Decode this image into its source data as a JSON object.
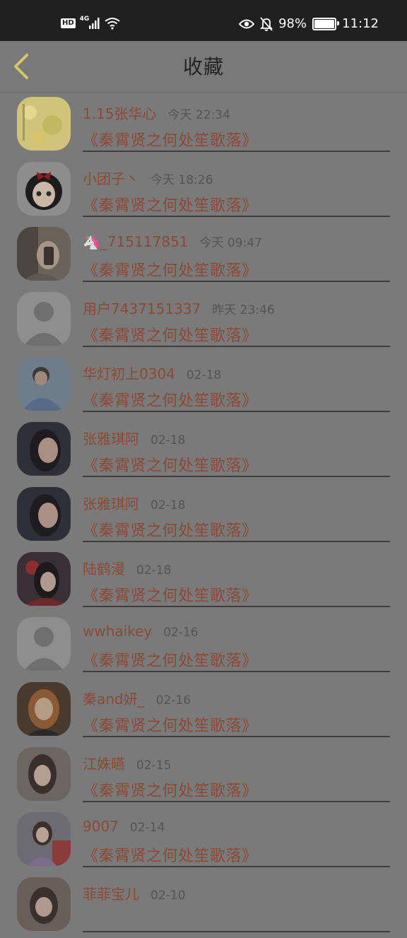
{
  "status_bar": {
    "hd": "HD",
    "network": "4G",
    "battery_percent": "98%",
    "battery_level": 0.98,
    "time": "11:12",
    "icons": [
      "hd-icon",
      "signal-icon",
      "wifi-icon",
      "eye-icon",
      "bell-muted-icon",
      "battery-icon"
    ]
  },
  "header": {
    "back_icon": "chevron-left-icon",
    "title": "收藏"
  },
  "colors": {
    "accent_text": "#8a4a36",
    "back_chevron": "#d6c36a",
    "overlay_bg": "#7a7a7a"
  },
  "favorites": [
    {
      "name": "1.15张华心",
      "time": "今天 22:34",
      "title": "《秦霄贤之何处笙歌落》",
      "avatar": "yellow-flowers"
    },
    {
      "name": "小团子丶",
      "time": "今天 18:26",
      "title": "《秦霄贤之何处笙歌落》",
      "avatar": "cartoon-girl"
    },
    {
      "name": "🦄_715117851",
      "time": "今天 09:47",
      "title": "《秦霄贤之何处笙歌落》",
      "avatar": "selfie"
    },
    {
      "name": "用户7437151337",
      "time": "昨天 23:46",
      "title": "《秦霄贤之何处笙歌落》",
      "avatar": "default"
    },
    {
      "name": "华灯初上0304",
      "time": "02-18",
      "title": "《秦霄贤之何处笙歌落》",
      "avatar": "boy-blue"
    },
    {
      "name": "张雅琪阿",
      "time": "02-18",
      "title": "《秦霄贤之何处笙歌落》",
      "avatar": "girl-dark"
    },
    {
      "name": "张雅琪阿",
      "time": "02-18",
      "title": "《秦霄贤之何处笙歌落》",
      "avatar": "girl-dark"
    },
    {
      "name": "陆鹤漫",
      "time": "02-18",
      "title": "《秦霄贤之何处笙歌落》",
      "avatar": "red-flower-girl"
    },
    {
      "name": "wwhaikey",
      "time": "02-16",
      "title": "《秦霄贤之何处笙歌落》",
      "avatar": "default"
    },
    {
      "name": "秦and妍_",
      "time": "02-16",
      "title": "《秦霄贤之何处笙歌落》",
      "avatar": "wizard-girl"
    },
    {
      "name": "江姝曣",
      "time": "02-15",
      "title": "《秦霄贤之何处笙歌落》",
      "avatar": "girl-light"
    },
    {
      "name": "9007",
      "time": "02-14",
      "title": "《秦霄贤之何处笙歌落》",
      "avatar": "street-girl"
    },
    {
      "name": "菲菲宝儿",
      "time": "02-10",
      "title": "",
      "avatar": "partial"
    }
  ]
}
